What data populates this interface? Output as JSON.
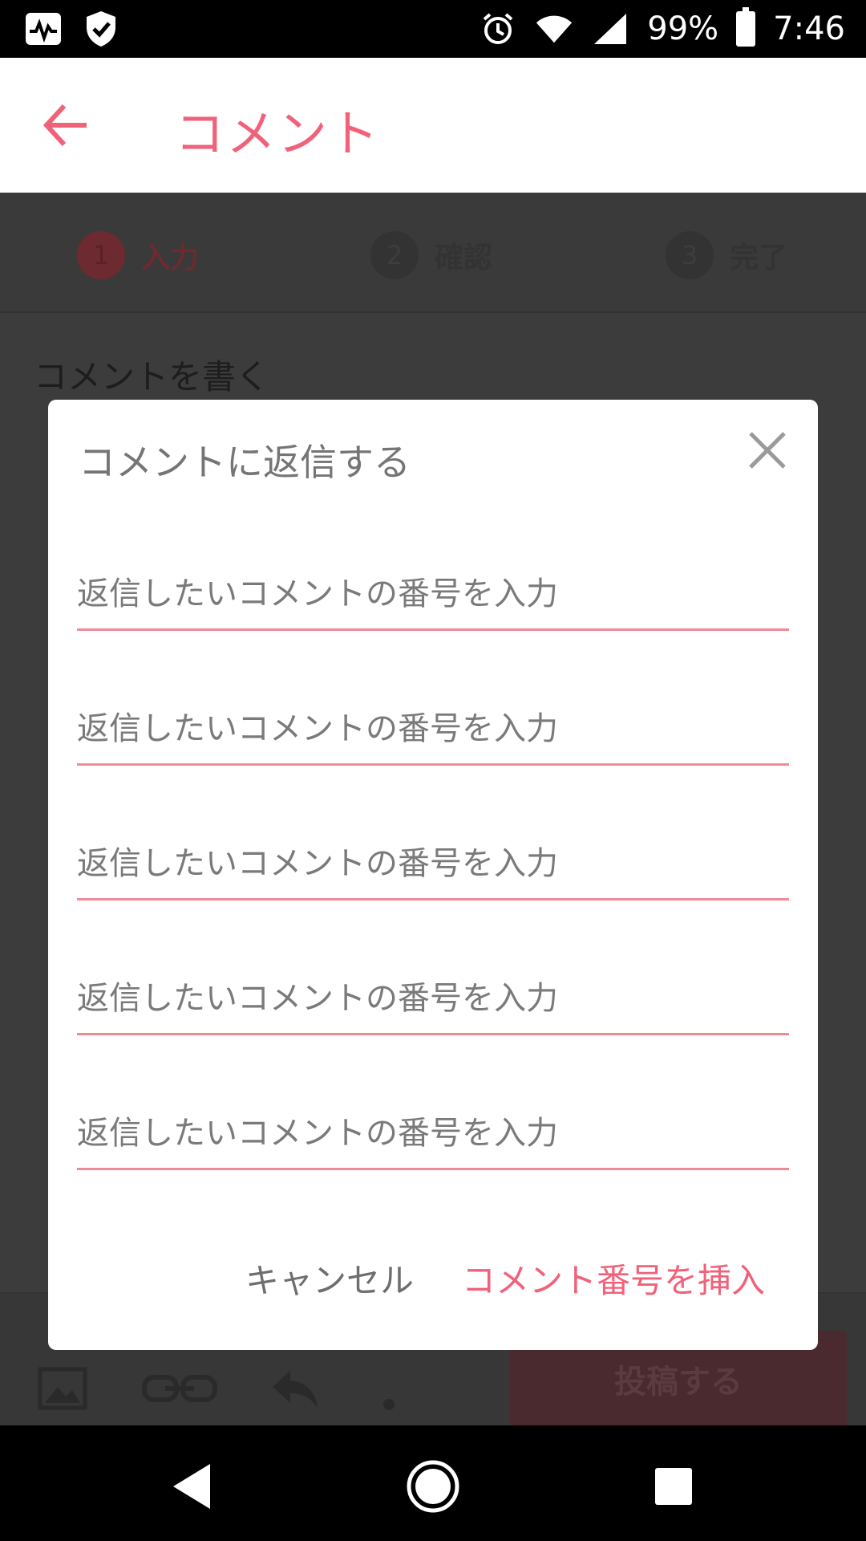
{
  "status_bar": {
    "left_icons": [
      "activity-icon",
      "shield-check-icon"
    ],
    "right_icons": [
      "alarm-icon",
      "wifi-icon",
      "cell-signal-icon"
    ],
    "battery_percent": "99%",
    "time": "7:46"
  },
  "app_bar": {
    "title": "コメント",
    "back_icon": "arrow-left-icon"
  },
  "background_page": {
    "steps": [
      {
        "number": "1",
        "label": "入力"
      },
      {
        "number": "2",
        "label": "確認"
      },
      {
        "number": "3",
        "label": "完了"
      }
    ],
    "section_label": "コメントを書く",
    "toolbar_icons": [
      "image-icon",
      "link-icon",
      "reply-icon",
      "more-icon"
    ],
    "post_button": "投稿する"
  },
  "dialog": {
    "title": "コメントに返信する",
    "close_icon": "close-icon",
    "fields": [
      {
        "placeholder": "返信したいコメントの番号を入力",
        "value": ""
      },
      {
        "placeholder": "返信したいコメントの番号を入力",
        "value": ""
      },
      {
        "placeholder": "返信したいコメントの番号を入力",
        "value": ""
      },
      {
        "placeholder": "返信したいコメントの番号を入力",
        "value": ""
      },
      {
        "placeholder": "返信したいコメントの番号を入力",
        "value": ""
      }
    ],
    "cancel_label": "キャンセル",
    "insert_label": "コメント番号を挿入"
  },
  "nav_bar": {
    "icons": [
      "back-triangle-icon",
      "home-circle-icon",
      "recents-square-icon"
    ]
  },
  "colors": {
    "accent": "#f0627a",
    "field_underline": "#ef8a96",
    "scrim": "#3a3a3a"
  }
}
